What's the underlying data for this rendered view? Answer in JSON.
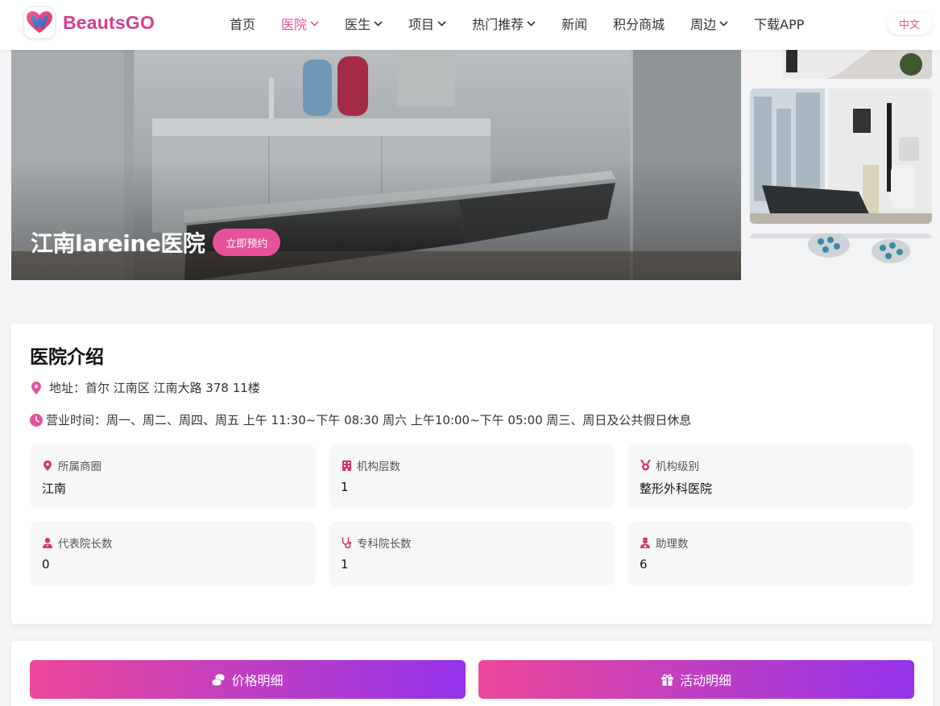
{
  "brand": {
    "name": "BeautsGO",
    "logo_icon": "heart-logo-icon"
  },
  "nav": {
    "items": [
      {
        "label": "首页",
        "has_dropdown": false,
        "active": false
      },
      {
        "label": "医院",
        "has_dropdown": true,
        "active": true
      },
      {
        "label": "医生",
        "has_dropdown": true,
        "active": false
      },
      {
        "label": "项目",
        "has_dropdown": true,
        "active": false
      },
      {
        "label": "热门推荐",
        "has_dropdown": true,
        "active": false
      },
      {
        "label": "新闻",
        "has_dropdown": false,
        "active": false
      },
      {
        "label": "积分商城",
        "has_dropdown": false,
        "active": false
      },
      {
        "label": "周边",
        "has_dropdown": true,
        "active": false
      },
      {
        "label": "下载APP",
        "has_dropdown": false,
        "active": false
      }
    ],
    "language": "中文"
  },
  "hero": {
    "hospital_name": "江南lareine医院",
    "book_label": "立即预约"
  },
  "intro": {
    "title": "医院介绍",
    "address": "地址：首尔 江南区 江南大路 378 11楼",
    "hours": "营业时间：周一、周二、周四、周五 上午 11:30~下午 08:30 周六 上午10:00~下午 05:00 周三、周日及公共假日休息",
    "stats": [
      {
        "label": "所属商圈",
        "value": "江南",
        "icon": "map-pin-icon"
      },
      {
        "label": "机构层数",
        "value": "1",
        "icon": "building-icon"
      },
      {
        "label": "机构级别",
        "value": "整形外科医院",
        "icon": "medal-icon"
      },
      {
        "label": "代表院长数",
        "value": "0",
        "icon": "doctor-icon"
      },
      {
        "label": "专科院长数",
        "value": "1",
        "icon": "stethoscope-icon"
      },
      {
        "label": "助理数",
        "value": "6",
        "icon": "nurse-icon"
      }
    ]
  },
  "actions": {
    "price_label": "价格明细",
    "activity_label": "活动明细"
  },
  "colors": {
    "accent": "#e8529a",
    "gradient_start": "#ec4899",
    "gradient_end": "#9333ea"
  }
}
